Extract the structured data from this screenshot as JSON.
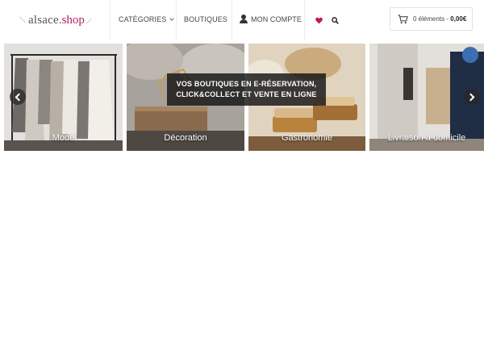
{
  "header": {
    "logo": {
      "part1": "alsace",
      "dot": ".",
      "part2": "shop"
    },
    "nav": {
      "categories": "CATÉGORIES",
      "boutiques": "BOUTIQUES",
      "account": "MON COMPTE"
    },
    "icons": {
      "wishlist": "heart-icon",
      "search": "search-icon",
      "account": "user-icon",
      "cart": "cart-icon"
    },
    "cart": {
      "items": "0 éléments - ",
      "total": "0,00€"
    }
  },
  "slider": {
    "banner": {
      "line1": "VOS BOUTIQUES EN E-RÉSERVATION,",
      "line2": "CLICK&COLLECT ET VENTE EN LIGNE"
    },
    "tiles": [
      {
        "label": "Mode"
      },
      {
        "label": "Décoration"
      },
      {
        "label": "Gastronomie"
      },
      {
        "label": "Livraison à domicile"
      }
    ]
  },
  "colors": {
    "brand": "#b0216a",
    "heart": "#c2185b"
  }
}
